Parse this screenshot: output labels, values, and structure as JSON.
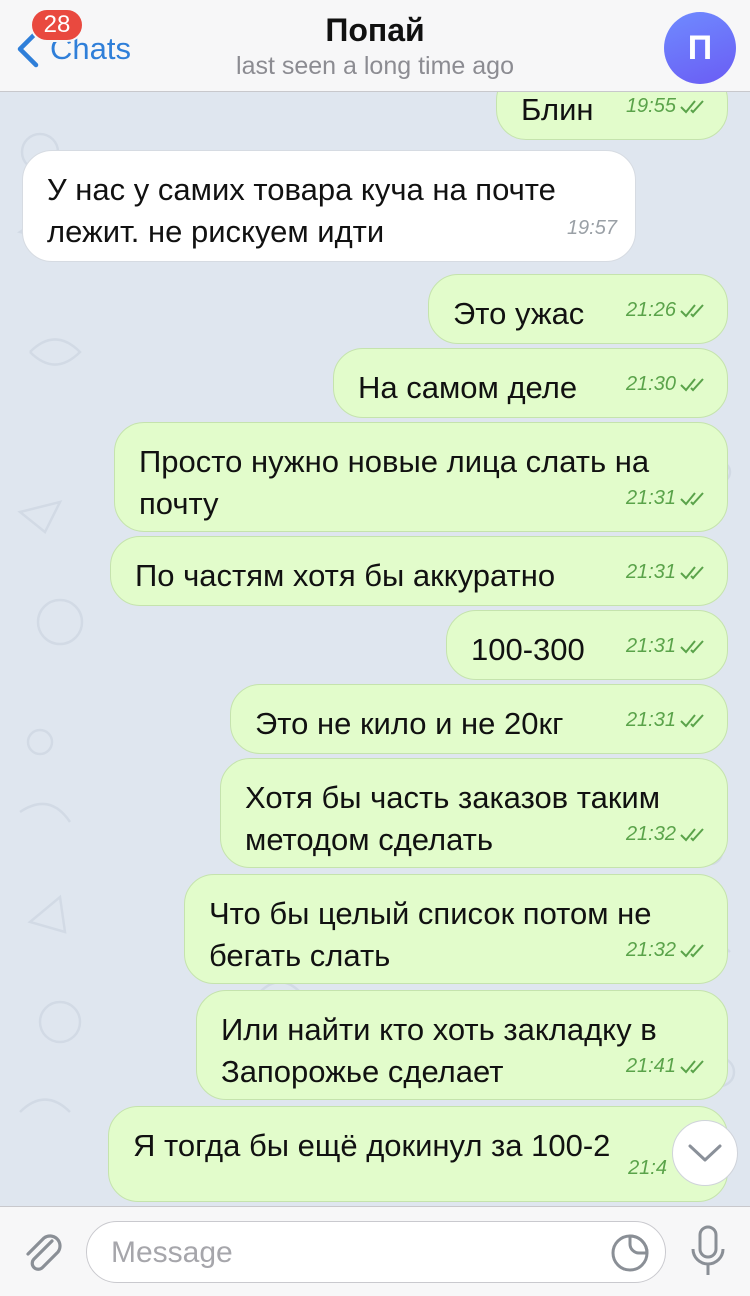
{
  "header": {
    "back_label": "Chats",
    "unread_badge": "28",
    "title": "Попай",
    "status": "last seen a long time ago",
    "avatar_initial": "П"
  },
  "messages": [
    {
      "direction": "out",
      "text": "Блин",
      "time": "19:55",
      "read": true
    },
    {
      "direction": "in",
      "text": "У нас у самих товара куча на почте лежит. не рискуем идти",
      "time": "19:57"
    },
    {
      "direction": "out",
      "text": "Это ужас",
      "time": "21:26",
      "read": true
    },
    {
      "direction": "out",
      "text": "На самом деле",
      "time": "21:30",
      "read": true
    },
    {
      "direction": "out",
      "text": "Просто нужно новые лица слать на почту",
      "time": "21:31",
      "read": true
    },
    {
      "direction": "out",
      "text": "По частям хотя бы аккуратно",
      "time": "21:31",
      "read": true
    },
    {
      "direction": "out",
      "text": "100-300",
      "time": "21:31",
      "read": true
    },
    {
      "direction": "out",
      "text": "Это не кило и не 20кг",
      "time": "21:31",
      "read": true
    },
    {
      "direction": "out",
      "text": "Хотя бы часть заказов таким методом сделать",
      "time": "21:32",
      "read": true
    },
    {
      "direction": "out",
      "text": "Что бы целый список потом не бегать слать",
      "time": "21:32",
      "read": true
    },
    {
      "direction": "out",
      "text": "Или найти кто хоть закладку в Запорожье сделает",
      "time": "21:41",
      "read": true
    },
    {
      "direction": "out",
      "text": "Я тогда бы ещё докинул за 100-2",
      "time": "21:4",
      "read": true
    }
  ],
  "input": {
    "placeholder": "Message"
  },
  "icons": {
    "back": "chevron-left-icon",
    "attach": "paperclip-icon",
    "sticker": "sticker-icon",
    "mic": "microphone-icon",
    "scroll": "chevron-down-icon"
  },
  "colors": {
    "accent": "#2f7fd9",
    "badge": "#e9493f",
    "outgoing_bubble": "#e2fccb",
    "incoming_bubble": "#ffffff",
    "read_ticks": "#5aa34a",
    "chat_background": "#dfe6ef"
  }
}
